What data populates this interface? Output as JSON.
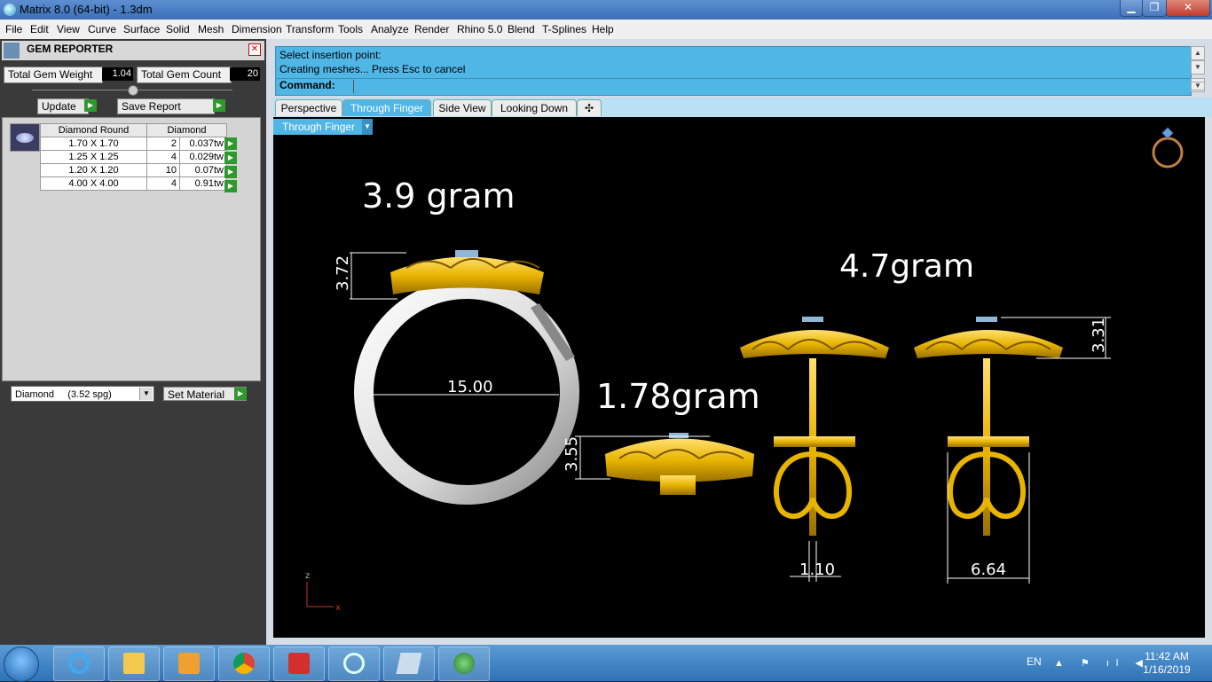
{
  "window": {
    "title": "Matrix 8.0 (64-bit) - 1.3dm",
    "min": "▁",
    "max": "❐",
    "close": "✕"
  },
  "menu": [
    "File",
    "Edit",
    "View",
    "Curve",
    "Surface",
    "Solid",
    "Mesh",
    "Dimension",
    "Transform",
    "Tools",
    "Analyze",
    "Render",
    "Rhino 5.0",
    "Blend",
    "T-Splines",
    "Help"
  ],
  "gem_reporter": {
    "title": "GEM REPORTER",
    "close": "✕",
    "total_weight_label": "Total Gem Weight",
    "total_weight_value": "1.04",
    "total_count_label": "Total Gem Count",
    "total_count_value": "20",
    "update_label": "Update",
    "save_report_label": "Save Report",
    "columns": [
      "Diamond Round",
      "Diamond"
    ],
    "rows": [
      {
        "size": "1.70 X 1.70",
        "count": "2",
        "weight": "0.037tw"
      },
      {
        "size": "1.25 X 1.25",
        "count": "4",
        "weight": "0.029tw"
      },
      {
        "size": "1.20 X 1.20",
        "count": "10",
        "weight": "0.07tw"
      },
      {
        "size": "4.00 X 4.00",
        "count": "4",
        "weight": "0.91tw"
      }
    ],
    "material_value": "Diamond     (3.52 spg)",
    "set_material_label": "Set Material"
  },
  "command": {
    "line1": "Select insertion point:",
    "line2": "Creating meshes... Press Esc to cancel",
    "label": "Command:"
  },
  "tabs": [
    "Perspective",
    "Through Finger",
    "Side View",
    "Looking Down"
  ],
  "tab_add": "✣",
  "active_tab": "Through Finger",
  "viewport": {
    "name": "Through Finger",
    "annotations": {
      "ring_weight": "3.9 gram",
      "earring_weight": "4.7gram",
      "small_weight": "1.78gram",
      "ring_height": "3.72",
      "ring_inner": "15.00",
      "side_height": "3.55",
      "earring_height": "3.31",
      "post_width": "1.10",
      "back_width": "6.64"
    },
    "axis_z": "z",
    "axis_x": "x"
  },
  "taskbar": {
    "language": "EN",
    "tray": "▲ ⚑ ıl ◀",
    "time": "11:42 AM",
    "date": "1/16/2019"
  },
  "colors": {
    "accent": "#4fb6e6",
    "gold": "#e8b400",
    "viewport_bg": "#000000"
  }
}
